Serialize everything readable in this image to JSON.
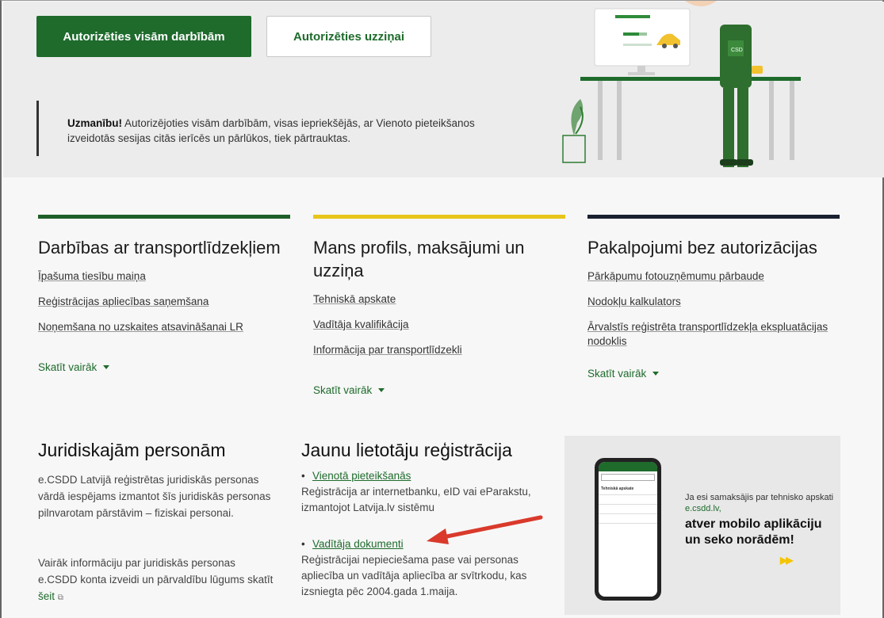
{
  "hero": {
    "btn_all_actions": "Autorizēties visām darbībām",
    "btn_inquiry": "Autorizēties uzziņai",
    "notice_bold": "Uzmanību!",
    "notice_text": " Autorizējoties visām darbībām, visas iepriekšējās, ar Vienoto pieteikšanos izveidotās sesijas citās ierīcēs un pārlūkos, tiek pārtrauktas."
  },
  "columns": [
    {
      "title": "Darbības ar transportlīdzekļiem",
      "accent": "#1e5f2a",
      "links": [
        "Īpašuma tiesību maiņa",
        "Reģistrācijas apliecības saņemšana",
        "Noņemšana no uzskaites atsavināšanai LR"
      ],
      "more": "Skatīt vairāk"
    },
    {
      "title": "Mans profils, maksājumi un uzziņa",
      "accent": "#e8c51a",
      "links": [
        "Tehniskā apskate",
        "Vadītāja kvalifikācija",
        "Informācija par transportlīdzekli"
      ],
      "more": "Skatīt vairāk"
    },
    {
      "title": "Pakalpojumi bez autorizācijas",
      "accent": "#1a2130",
      "links": [
        "Pārkāpumu fotouzņēmumu pārbaude",
        "Nodokļu kalkulators",
        "Ārvalstīs reģistrēta transportlīdzekļa ekspluatācijas nodoklis"
      ],
      "more": "Skatīt vairāk"
    }
  ],
  "legal": {
    "title": "Juridiskajām personām",
    "text1": "e.CSDD Latvijā reģistrētas juridiskās personas vārdā iespējams izmantot šīs juridiskās personas pilnvarotam pārstāvim – fiziskai personai.",
    "text2": "Vairāk informāciju par juridiskās personas e.CSDD konta izveidi un pārvaldību lūgums skatīt ",
    "link": "šeit",
    "link_icon": "external-link-icon"
  },
  "registration": {
    "title": "Jaunu lietotāju reģistrācija",
    "items": [
      {
        "title": "Vienotā pieteikšanās",
        "desc": "Reģistrācija ar internetbanku, eID vai eParakstu, izmantojot Latvija.lv sistēmu"
      },
      {
        "title": "Vadītāja dokumenti",
        "desc": "Reģistrācijai nepieciešama pase vai personas apliecība un vadītāja apliecība ar svītrkodu, kas izsniegta pēc 2004.gada 1.maija."
      }
    ]
  },
  "promo": {
    "small_text": "Ja esi samaksājis par tehnisko apskati ",
    "small_link": "e.csdd.lv,",
    "big_text": "atver mobilo aplikāciju un seko norādēm!",
    "phone_title": "Tehniskā apskate",
    "arrows": "▶▶"
  },
  "colors": {
    "brand_green": "#1e6b2c",
    "accent_yellow": "#e8c51a",
    "arrow_red": "#d93a2b"
  }
}
